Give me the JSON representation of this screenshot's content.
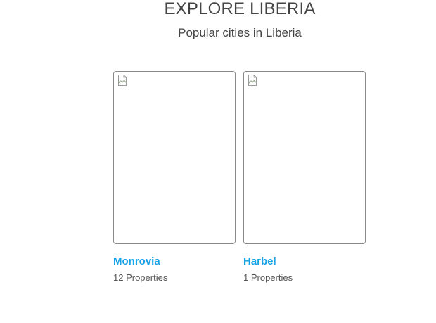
{
  "header": {
    "title": "EXPLORE LIBERIA",
    "subtitle": "Popular cities in Liberia"
  },
  "cities": [
    {
      "name": "Monrovia",
      "count": "12 Properties",
      "image_icon": "broken-image-icon"
    },
    {
      "name": "Harbel",
      "count": "1 Properties",
      "image_icon": "broken-image-icon"
    }
  ],
  "colors": {
    "link": "#1aa3e8",
    "text": "#444444",
    "border": "#8a8a8a"
  }
}
